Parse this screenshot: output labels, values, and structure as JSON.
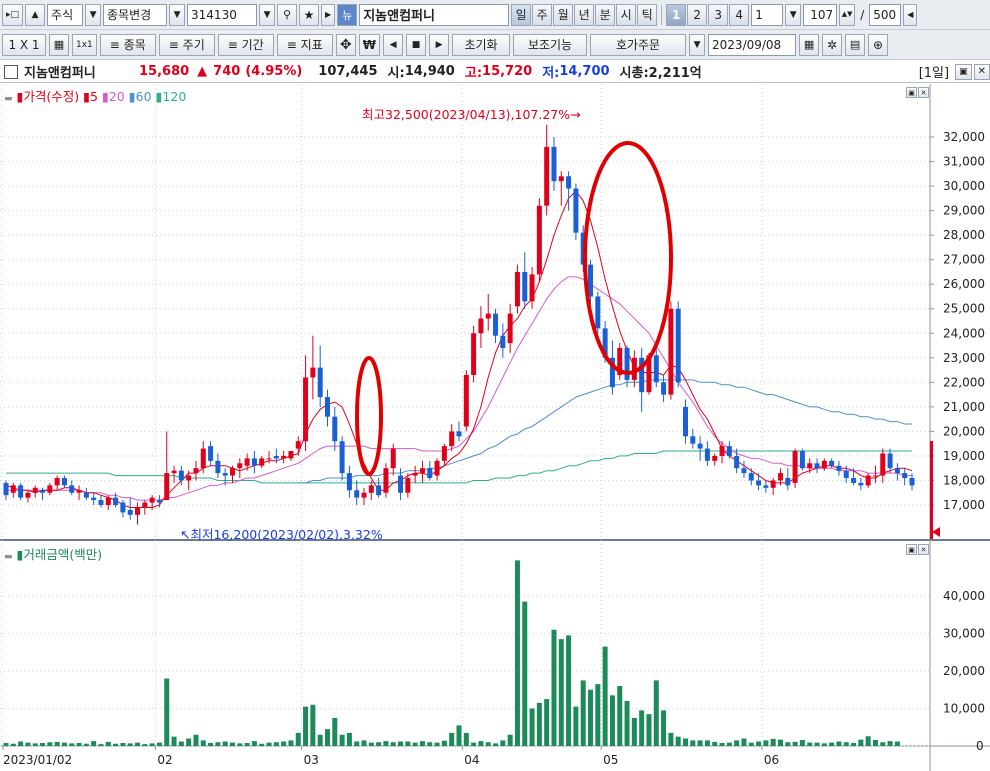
{
  "toolbar1": {
    "market": "주식",
    "change_label": "종목변경",
    "code": "314130",
    "news_label": "뉴",
    "name": "지놈앤컴퍼니",
    "periods": [
      "일",
      "주",
      "월",
      "년",
      "분",
      "시",
      "틱"
    ],
    "multi": [
      "1",
      "2",
      "3",
      "4"
    ],
    "interval": "1",
    "count": "107",
    "total": "500",
    "slash": "/"
  },
  "toolbar2": {
    "layout_label": "1 X 1",
    "icon_label": "1x1",
    "items_label": "≡ 종목",
    "period_label": "≡ 주기",
    "range_label": "≡ 기간",
    "indicator_label": "≡ 지표",
    "won_label": "₩",
    "reset_label": "초기화",
    "aux_label": "보조기능",
    "order_label": "호가주문",
    "date": "2023/09/08"
  },
  "info": {
    "name": "지놈앤컴퍼니",
    "price": "15,680",
    "arrow": "▲",
    "change": "740",
    "pct": "(4.95%)",
    "volume": "107,445",
    "open_label": "시:",
    "open": "14,940",
    "high_label": "고:",
    "high": "15,720",
    "low_label": "저:",
    "low": "14,700",
    "cap_label": "시총:",
    "cap": "2,211억",
    "period": "[1일]"
  },
  "colors": {
    "up": "#e0001b",
    "down": "#1a5fd6",
    "ma5": "#e0001b",
    "ma20": "#d75bd0",
    "ma60": "#4a8fd6",
    "ma120": "#2fae8f",
    "volume": "#1d8a5a"
  },
  "price_panel": {
    "legend_title": "가격(수정)",
    "ma": [
      "5",
      "20",
      "60",
      "120"
    ],
    "yticks": [
      "32,000",
      "31,000",
      "30,000",
      "29,000",
      "28,000",
      "27,000",
      "26,000",
      "25,000",
      "24,000",
      "23,000",
      "22,000",
      "21,000",
      "20,000",
      "19,000",
      "18,000",
      "17,000"
    ],
    "high_note": "최고32,500(2023/04/13),107.27%",
    "low_note": "최저16,200(2023/02/02),3.32%"
  },
  "volume_panel": {
    "legend_title": "거래금액(백만)",
    "yticks": [
      "40,000",
      "30,000",
      "20,000",
      "10,000",
      "0"
    ]
  },
  "xaxis": {
    "labels": [
      "2023/01/02",
      "02",
      "03",
      "04",
      "05",
      "06"
    ]
  },
  "chart_data": {
    "type": "candlestick",
    "ohlc_2023": [
      [
        17.9,
        18.0,
        17.2,
        17.4
      ],
      [
        17.5,
        17.9,
        17.3,
        17.8
      ],
      [
        17.8,
        17.9,
        17.2,
        17.3
      ],
      [
        17.3,
        17.6,
        17.1,
        17.5
      ],
      [
        17.5,
        17.8,
        17.3,
        17.7
      ],
      [
        17.6,
        17.7,
        17.2,
        17.5
      ],
      [
        17.5,
        17.9,
        17.4,
        17.8
      ],
      [
        17.8,
        18.2,
        17.6,
        18.1
      ],
      [
        18.1,
        18.2,
        17.7,
        17.8
      ],
      [
        17.8,
        18.0,
        17.4,
        17.5
      ],
      [
        17.5,
        17.8,
        17.2,
        17.6
      ],
      [
        17.5,
        17.7,
        17.2,
        17.3
      ],
      [
        17.3,
        17.5,
        17.0,
        17.2
      ],
      [
        17.2,
        17.4,
        16.9,
        17.0
      ],
      [
        17.0,
        17.4,
        16.8,
        17.3
      ],
      [
        17.3,
        17.5,
        16.9,
        17.0
      ],
      [
        17.1,
        17.2,
        16.5,
        16.7
      ],
      [
        16.8,
        17.3,
        16.4,
        16.6
      ],
      [
        16.6,
        17.1,
        16.2,
        16.9
      ],
      [
        16.9,
        17.2,
        16.6,
        17.1
      ],
      [
        17.1,
        17.4,
        16.8,
        17.3
      ],
      [
        17.2,
        17.4,
        16.9,
        17.1
      ],
      [
        17.2,
        20.0,
        17.2,
        18.3
      ],
      [
        18.3,
        18.6,
        17.9,
        18.4
      ],
      [
        18.4,
        18.6,
        17.8,
        18.0
      ],
      [
        18.0,
        18.4,
        17.6,
        18.2
      ],
      [
        18.3,
        18.8,
        18.0,
        18.5
      ],
      [
        18.5,
        19.6,
        18.3,
        19.3
      ],
      [
        19.4,
        19.6,
        18.6,
        18.8
      ],
      [
        18.8,
        19.1,
        18.1,
        18.3
      ],
      [
        18.3,
        18.5,
        17.8,
        18.2
      ],
      [
        18.2,
        18.6,
        17.9,
        18.5
      ],
      [
        18.5,
        18.9,
        18.1,
        18.7
      ],
      [
        18.6,
        19.1,
        18.4,
        18.9
      ],
      [
        18.9,
        19.2,
        18.3,
        18.6
      ],
      [
        18.6,
        19.0,
        18.5,
        18.9
      ],
      [
        18.9,
        19.2,
        18.7,
        18.9
      ],
      [
        19.0,
        19.3,
        18.7,
        18.9
      ],
      [
        18.9,
        19.2,
        18.7,
        19.0
      ],
      [
        18.9,
        19.1,
        18.8,
        19.2
      ],
      [
        19.3,
        19.8,
        19.0,
        19.6
      ],
      [
        19.6,
        23.1,
        19.2,
        22.2
      ],
      [
        22.2,
        23.9,
        21.3,
        22.6
      ],
      [
        22.6,
        23.5,
        21.0,
        21.4
      ],
      [
        21.4,
        21.7,
        20.2,
        20.6
      ],
      [
        20.6,
        21.0,
        19.2,
        19.6
      ],
      [
        19.6,
        19.8,
        18.0,
        18.3
      ],
      [
        18.3,
        18.6,
        17.3,
        17.6
      ],
      [
        17.6,
        18.0,
        17.0,
        17.3
      ],
      [
        17.3,
        17.7,
        17.0,
        17.5
      ],
      [
        17.5,
        18.0,
        17.2,
        17.8
      ],
      [
        17.8,
        18.1,
        17.3,
        17.4
      ],
      [
        17.5,
        18.7,
        17.3,
        18.5
      ],
      [
        18.5,
        19.5,
        18.2,
        19.3
      ],
      [
        18.2,
        18.5,
        17.2,
        17.5
      ],
      [
        17.5,
        18.3,
        17.3,
        18.1
      ],
      [
        18.2,
        18.6,
        17.9,
        18.3
      ],
      [
        18.3,
        18.8,
        17.9,
        18.5
      ],
      [
        18.5,
        18.8,
        18.0,
        18.1
      ],
      [
        18.2,
        18.9,
        18.0,
        18.8
      ],
      [
        18.8,
        19.5,
        18.6,
        19.4
      ],
      [
        19.4,
        20.3,
        19.2,
        20.0
      ],
      [
        20.0,
        20.4,
        19.6,
        19.8
      ],
      [
        20.2,
        22.5,
        20.0,
        22.3
      ],
      [
        22.3,
        24.3,
        22.0,
        24.0
      ],
      [
        24.0,
        25.1,
        23.4,
        24.6
      ],
      [
        24.6,
        25.6,
        24.1,
        24.8
      ],
      [
        24.8,
        25.0,
        23.6,
        23.9
      ],
      [
        23.9,
        24.4,
        23.0,
        23.4
      ],
      [
        23.6,
        25.2,
        23.2,
        24.8
      ],
      [
        25.1,
        26.8,
        24.8,
        26.5
      ],
      [
        26.5,
        27.3,
        25.0,
        25.3
      ],
      [
        25.3,
        26.7,
        25.0,
        26.4
      ],
      [
        26.4,
        29.5,
        26.1,
        29.2
      ],
      [
        29.2,
        32.5,
        28.8,
        31.6
      ],
      [
        31.6,
        32.0,
        29.8,
        30.2
      ],
      [
        30.2,
        30.6,
        29.2,
        30.4
      ],
      [
        30.4,
        30.6,
        29.0,
        29.9
      ],
      [
        29.9,
        30.1,
        27.8,
        28.1
      ],
      [
        28.1,
        28.4,
        26.5,
        26.8
      ],
      [
        26.8,
        27.0,
        25.2,
        25.5
      ],
      [
        25.5,
        25.7,
        24.0,
        24.2
      ],
      [
        24.2,
        24.5,
        22.8,
        23.0
      ],
      [
        23.0,
        23.7,
        21.5,
        21.8
      ],
      [
        22.3,
        23.6,
        22.1,
        23.4
      ],
      [
        23.4,
        23.5,
        21.8,
        22.1
      ],
      [
        22.1,
        23.3,
        21.8,
        23.0
      ],
      [
        23.0,
        23.4,
        20.8,
        21.6
      ],
      [
        21.6,
        23.2,
        21.5,
        23.1
      ],
      [
        23.1,
        23.4,
        21.8,
        22.0
      ],
      [
        22.0,
        22.3,
        21.2,
        21.5
      ],
      [
        21.5,
        25.3,
        21.3,
        25.0
      ],
      [
        25.0,
        25.3,
        21.8,
        22.0
      ],
      [
        21.0,
        21.3,
        19.5,
        19.8
      ],
      [
        19.8,
        20.1,
        19.3,
        19.5
      ],
      [
        19.5,
        19.8,
        18.8,
        19.3
      ],
      [
        19.3,
        19.6,
        18.6,
        18.8
      ],
      [
        18.8,
        19.1,
        18.6,
        19.0
      ],
      [
        19.0,
        19.6,
        18.7,
        19.4
      ],
      [
        19.4,
        19.6,
        18.9,
        19.0
      ],
      [
        19.0,
        19.3,
        18.3,
        18.5
      ],
      [
        18.5,
        18.8,
        18.1,
        18.3
      ],
      [
        18.3,
        18.5,
        17.8,
        18.0
      ],
      [
        18.0,
        18.3,
        17.6,
        17.8
      ],
      [
        17.8,
        18.0,
        17.5,
        17.7
      ],
      [
        17.7,
        18.1,
        17.4,
        18.0
      ],
      [
        18.0,
        18.5,
        17.8,
        18.3
      ],
      [
        18.1,
        18.5,
        17.6,
        17.8
      ],
      [
        17.9,
        19.3,
        17.7,
        19.2
      ],
      [
        19.2,
        19.3,
        18.4,
        18.5
      ],
      [
        18.5,
        18.9,
        18.3,
        18.7
      ],
      [
        18.7,
        18.9,
        18.3,
        18.5
      ],
      [
        18.5,
        18.9,
        18.4,
        18.8
      ],
      [
        18.8,
        18.9,
        18.5,
        18.6
      ],
      [
        18.6,
        18.8,
        18.2,
        18.4
      ],
      [
        18.4,
        18.6,
        17.9,
        18.1
      ],
      [
        18.1,
        18.5,
        17.8,
        17.9
      ],
      [
        17.9,
        18.1,
        17.6,
        17.8
      ],
      [
        17.8,
        18.3,
        17.7,
        18.2
      ],
      [
        18.2,
        18.6,
        17.9,
        18.2
      ],
      [
        18.2,
        19.3,
        17.9,
        19.1
      ],
      [
        19.1,
        19.3,
        18.3,
        18.5
      ],
      [
        18.5,
        18.7,
        18.0,
        18.3
      ],
      [
        18.3,
        18.5,
        17.8,
        18.1
      ],
      [
        18.1,
        18.3,
        17.6,
        17.8
      ]
    ],
    "volume_millions": [
      800,
      600,
      1200,
      900,
      700,
      800,
      1000,
      1100,
      900,
      700,
      800,
      600,
      1300,
      500,
      1100,
      600,
      800,
      700,
      900,
      500,
      700,
      900,
      18000,
      2500,
      1200,
      2000,
      3000,
      1500,
      800,
      1000,
      1200,
      900,
      700,
      800,
      1300,
      600,
      900,
      1000,
      1200,
      1500,
      3500,
      10500,
      11000,
      3000,
      4500,
      7500,
      3000,
      3500,
      1200,
      1500,
      900,
      1000,
      1300,
      1000,
      1200,
      1200,
      900,
      1300,
      1000,
      900,
      1400,
      3500,
      5500,
      3500,
      900,
      1300,
      1000,
      700,
      1500,
      3000,
      49500,
      38500,
      10000,
      11500,
      12500,
      31000,
      28500,
      29500,
      10500,
      17500,
      15000,
      16500,
      26500,
      13500,
      16000,
      12000,
      7500,
      9500,
      8500,
      17500,
      9500,
      3500,
      2500,
      2000,
      1500,
      1500,
      1500,
      1100,
      800,
      900,
      1500,
      2000,
      900,
      1200,
      1500,
      1900,
      1700,
      1000,
      1100,
      1600,
      900,
      900,
      700,
      900,
      1200,
      1000,
      800,
      1700,
      2600,
      1600,
      1000,
      1300,
      1200
    ],
    "ma5": [
      17.8,
      17.7,
      17.6,
      17.6,
      17.5,
      17.6,
      17.6,
      17.6,
      17.7,
      17.7,
      17.6,
      17.5,
      17.5,
      17.4,
      17.3,
      17.2,
      17.0,
      16.9,
      16.9,
      16.9,
      16.9,
      17.0,
      17.4,
      17.7,
      18.0,
      18.3,
      18.3,
      18.5,
      18.6,
      18.6,
      18.6,
      18.5,
      18.4,
      18.5,
      18.6,
      18.7,
      18.8,
      18.8,
      18.9,
      19.0,
      19.1,
      19.9,
      20.5,
      20.9,
      21.1,
      21.2,
      21.0,
      20.3,
      19.5,
      18.7,
      18.1,
      17.6,
      17.6,
      17.9,
      18.0,
      18.2,
      18.3,
      18.3,
      18.2,
      18.4,
      18.6,
      18.9,
      19.1,
      19.5,
      20.1,
      21.0,
      22.2,
      23.2,
      23.9,
      24.3,
      24.6,
      25.1,
      25.4,
      26.1,
      27.0,
      28.0,
      28.8,
      29.5,
      29.8,
      29.4,
      28.6,
      27.5,
      26.2,
      25.1,
      24.1,
      23.3,
      22.6,
      22.4,
      22.4,
      22.4,
      22.3,
      22.7,
      22.6,
      22.1,
      21.5,
      20.9,
      20.5,
      19.9,
      19.3,
      19.0,
      18.8,
      18.6,
      18.4,
      18.2,
      18.0,
      17.9,
      17.9,
      17.9,
      18.1,
      18.3,
      18.4,
      18.5,
      18.6,
      18.6,
      18.5,
      18.5,
      18.4,
      18.2,
      18.1,
      18.1,
      18.3,
      18.4,
      18.5,
      18.5,
      18.4
    ],
    "ma20": [
      17.6,
      17.6,
      17.6,
      17.6,
      17.6,
      17.6,
      17.6,
      17.6,
      17.6,
      17.6,
      17.6,
      17.5,
      17.5,
      17.5,
      17.4,
      17.4,
      17.3,
      17.3,
      17.2,
      17.2,
      17.2,
      17.2,
      17.3,
      17.3,
      17.4,
      17.5,
      17.6,
      17.7,
      17.8,
      17.8,
      17.9,
      17.9,
      18.0,
      18.1,
      18.1,
      18.2,
      18.3,
      18.4,
      18.5,
      18.6,
      18.7,
      18.9,
      19.1,
      19.3,
      19.4,
      19.4,
      19.4,
      19.4,
      19.4,
      19.4,
      19.3,
      19.3,
      19.3,
      19.3,
      19.3,
      19.3,
      19.3,
      19.2,
      19.2,
      19.2,
      19.2,
      19.3,
      19.4,
      19.7,
      20.0,
      20.5,
      21.0,
      21.6,
      22.2,
      22.8,
      23.4,
      23.9,
      24.4,
      24.9,
      25.4,
      25.8,
      26.1,
      26.3,
      26.3,
      26.2,
      26.0,
      25.8,
      25.6,
      25.4,
      25.2,
      24.9,
      24.6,
      24.3,
      24.0,
      23.5,
      23.0,
      22.5,
      22.0,
      21.6,
      21.2,
      20.7,
      20.2,
      19.8,
      19.5,
      19.3,
      19.1,
      19.0,
      18.9,
      18.9,
      18.8,
      18.7,
      18.7,
      18.6,
      18.6,
      18.6,
      18.5,
      18.5,
      18.5,
      18.5,
      18.4,
      18.4,
      18.4,
      18.4,
      18.3,
      18.3,
      18.3,
      18.3,
      18.3,
      18.2,
      18.2
    ],
    "ma60": [
      null,
      null,
      null,
      null,
      null,
      null,
      null,
      null,
      null,
      null,
      null,
      null,
      null,
      null,
      null,
      null,
      null,
      null,
      null,
      null,
      null,
      null,
      null,
      null,
      null,
      null,
      null,
      null,
      null,
      null,
      null,
      null,
      null,
      null,
      null,
      null,
      null,
      null,
      null,
      null,
      17.9,
      17.9,
      18.0,
      18.0,
      18.1,
      18.1,
      18.1,
      18.1,
      18.2,
      18.2,
      18.2,
      18.2,
      18.3,
      18.3,
      18.3,
      18.4,
      18.4,
      18.4,
      18.5,
      18.5,
      18.6,
      18.7,
      18.8,
      18.9,
      19.0,
      19.1,
      19.3,
      19.4,
      19.6,
      19.8,
      19.9,
      20.1,
      20.2,
      20.4,
      20.6,
      20.8,
      21.0,
      21.2,
      21.4,
      21.5,
      21.6,
      21.7,
      21.8,
      21.9,
      21.9,
      22.0,
      22.0,
      22.0,
      22.1,
      22.1,
      22.1,
      22.1,
      22.1,
      22.1,
      22.1,
      22.0,
      22.0,
      22.0,
      21.9,
      21.9,
      21.8,
      21.8,
      21.7,
      21.6,
      21.5,
      21.5,
      21.4,
      21.3,
      21.2,
      21.1,
      21.0,
      21.0,
      20.9,
      20.8,
      20.8,
      20.7,
      20.7,
      20.6,
      20.6,
      20.5,
      20.5,
      20.4,
      20.4,
      20.3,
      20.3
    ],
    "ma120": [
      18.3,
      18.3,
      18.3,
      18.3,
      18.3,
      18.3,
      18.3,
      18.3,
      18.3,
      18.3,
      18.3,
      18.3,
      18.3,
      18.3,
      18.3,
      18.2,
      18.2,
      18.2,
      18.2,
      18.2,
      18.2,
      18.2,
      18.2,
      18.2,
      18.1,
      18.1,
      18.1,
      18.1,
      18.1,
      18.0,
      18.0,
      18.0,
      18.0,
      18.0,
      18.0,
      17.9,
      17.9,
      17.9,
      17.9,
      17.9,
      17.9,
      17.9,
      17.9,
      17.9,
      17.9,
      17.9,
      17.9,
      17.9,
      17.9,
      17.9,
      17.9,
      17.9,
      17.9,
      17.9,
      17.9,
      17.9,
      17.9,
      17.9,
      17.9,
      17.9,
      17.9,
      17.9,
      17.9,
      17.9,
      18.0,
      18.0,
      18.0,
      18.1,
      18.1,
      18.1,
      18.2,
      18.2,
      18.3,
      18.3,
      18.4,
      18.4,
      18.5,
      18.6,
      18.6,
      18.7,
      18.8,
      18.8,
      18.9,
      18.9,
      19.0,
      19.0,
      19.1,
      19.1,
      19.1,
      19.1,
      19.2,
      19.2,
      19.2,
      19.2,
      19.2,
      19.2,
      19.2,
      19.2,
      19.2,
      19.2,
      19.2,
      19.2,
      19.2,
      19.2,
      19.2,
      19.2,
      19.2,
      19.2,
      19.2,
      19.2,
      19.2,
      19.2,
      19.2,
      19.2,
      19.2,
      19.2,
      19.2,
      19.2,
      19.2,
      19.2,
      19.2,
      19.2,
      19.2,
      19.2,
      19.2
    ]
  }
}
